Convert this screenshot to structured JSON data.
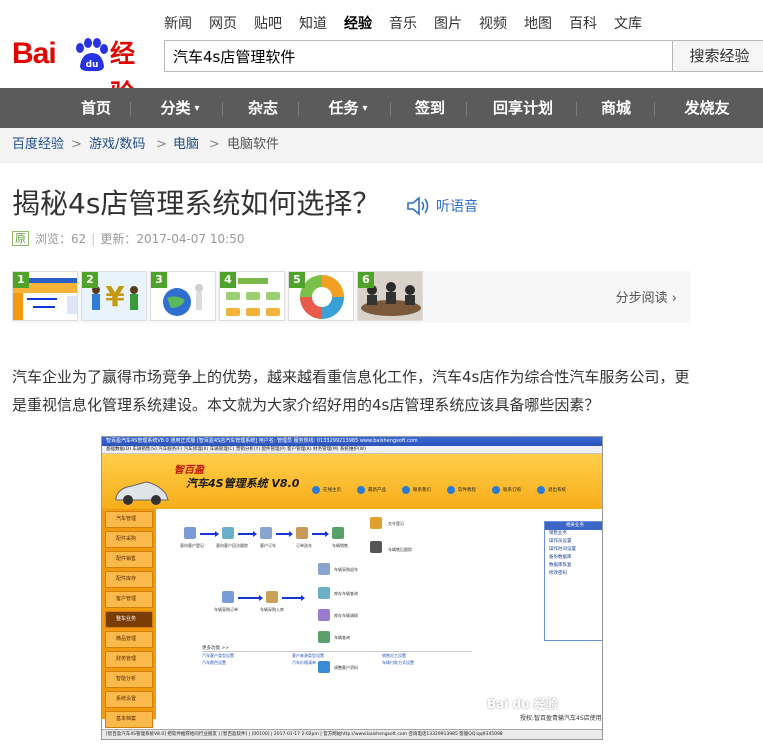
{
  "header": {
    "logo_text": "Bai",
    "logo_du": "du",
    "logo_jingyan": "经验",
    "topnav": [
      "新闻",
      "网页",
      "贴吧",
      "知道",
      "经验",
      "音乐",
      "图片",
      "视频",
      "地图",
      "百科",
      "文库"
    ],
    "topnav_active": "经验",
    "search_value": "汽车4s店管理软件",
    "search_button": "搜索经验"
  },
  "mainnav": [
    {
      "label": "首页",
      "caret": ""
    },
    {
      "label": "分类",
      "caret": "▾"
    },
    {
      "label": "杂志",
      "caret": ""
    },
    {
      "label": "任务",
      "caret": "▾"
    },
    {
      "label": "签到",
      "caret": ""
    },
    {
      "label": "回享计划",
      "caret": ""
    },
    {
      "label": "商城",
      "caret": ""
    },
    {
      "label": "发烧友",
      "caret": ""
    }
  ],
  "breadcrumb": [
    "百度经验",
    "游戏/数码",
    "电脑",
    "电脑软件"
  ],
  "breadcrumb_sep": ">",
  "article": {
    "title": "揭秘4s店管理系统如何选择？",
    "listen": "听语音",
    "badge": "原",
    "views_label": "浏览：62",
    "updated_label": "更新：2017-04-07 10:50",
    "divider": "|",
    "step_read": "分步阅读 ›",
    "thumbs": [
      "1",
      "2",
      "3",
      "4",
      "5",
      "6"
    ],
    "intro": "汽车企业为了赢得市场竞争上的优势，越来越看重信息化工作，汽车4s店作为综合性汽车服务公司，更是重视信息化管理系统建设。本文就为大家介绍好用的4s店管理系统应该具备哪些因素？"
  },
  "screenshot": {
    "titlebar": "智百盈汽车4S管理系统V8.0 通用正式版  [智百盈4S店汽车管理系统]  用户名: 管理员  服务热线: 0133299213985  www.baishengsoft.com",
    "menubar": "基础数据(D)   车辆销售(S)   汽车服务(F)   汽车修理(X)   车辆管理(C)   营销分析(Y)   配件管理(P)   客户管理(K)   财务管理(M)   系统维护(W)",
    "brand_cn": "智百盈",
    "brand_title": "汽车4S管理系统 V8.0",
    "banner_items": [
      "在线主页",
      "最新产品",
      "联系我们",
      "软件教程",
      "联系订购",
      "退出系统"
    ],
    "side_menu": [
      "汽车管理",
      "配件采购",
      "配件销售",
      "配件库存",
      "客户管理",
      "整车业务",
      "精品管理",
      "财务管理",
      "智能分析",
      "系统设置",
      "基本档案",
      "退出系统"
    ],
    "side_active": "整车业务",
    "flow_top": [
      "意向客户登记",
      "意向客户回访跟踪",
      "客户订车",
      "订单选车",
      "车辆销售"
    ],
    "flow_top_right": [
      "交车登记",
      "车辆售后跟踪"
    ],
    "flow_bottom": [
      "车辆采购订单",
      "车辆采购入库"
    ],
    "flow_bottom_right": [
      "车辆采购退车",
      "库存车辆查询",
      "库存车辆调拨",
      "车辆查询"
    ],
    "flow_bottom_end": "调整客户资料",
    "right_panel_title": "相关业务",
    "right_panel_items": [
      "销售业务",
      "操作员设置",
      "操作时间设置",
      "备份数据库",
      "数据库恢复",
      "修改密码"
    ],
    "links_title": "更多功能 >>",
    "links_rows": [
      [
        "汽车客户类型设置",
        "客户来源类型设置",
        "销售员工设置"
      ],
      [
        "汽车颜色设置",
        "汽车价格清单",
        "车辆付款方式设置"
      ]
    ],
    "watermark": "Bai du 经验",
    "credit": "授权:智百盈青输汽车4S店使用",
    "statusbar": "[智百盈汽车4S管理系统V8.0] 把软件推荐给同行业朋友  |  [智百盈软件]  |  [00100]  |  2017-01-17 2:02pm  |  官方网站http://www.baishengsoft.com  咨询电话13329913985  客服QQ:qq9345098"
  }
}
